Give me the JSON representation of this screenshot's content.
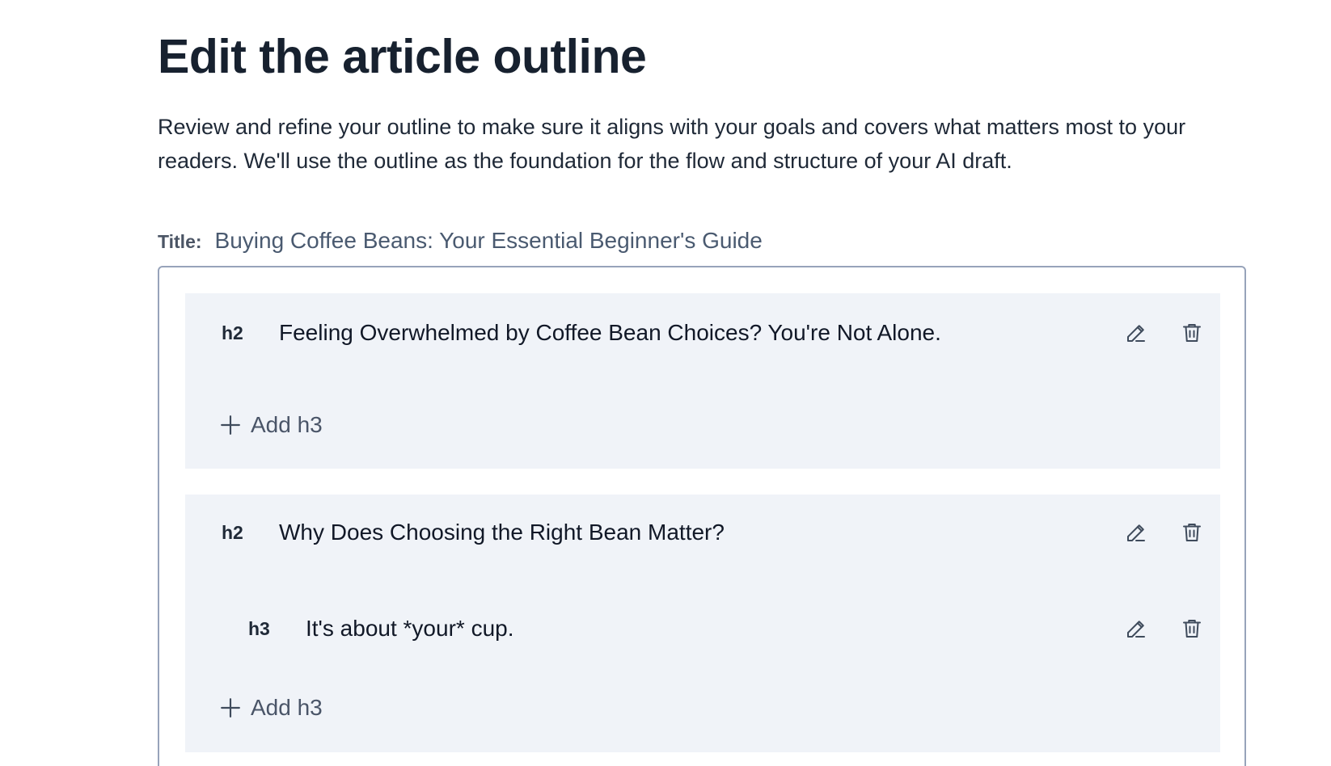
{
  "page": {
    "heading": "Edit the article outline",
    "description": "Review and refine your outline to make sure it aligns with your goals and covers what matters most to your readers. We'll use the outline as the foundation for the flow and structure of your AI draft."
  },
  "article": {
    "title_label": "Title:",
    "title_value": "Buying Coffee Beans: Your Essential Beginner's Guide"
  },
  "outline": {
    "sections": [
      {
        "level": "h2",
        "text": "Feeling Overwhelmed by Coffee Bean Choices? You're Not Alone.",
        "subsections": [],
        "add_label": "Add h3"
      },
      {
        "level": "h2",
        "text": "Why Does Choosing the Right Bean Matter?",
        "subsections": [
          {
            "level": "h3",
            "text": "It's about *your* cup."
          }
        ],
        "add_label": "Add h3"
      }
    ]
  },
  "icons": {
    "edit": "pencil-icon",
    "delete": "trash-icon",
    "add": "plus-icon"
  },
  "colors": {
    "section_bg": "#f0f3f8",
    "border": "#97a3ba",
    "icon": "#3f4b5c"
  }
}
